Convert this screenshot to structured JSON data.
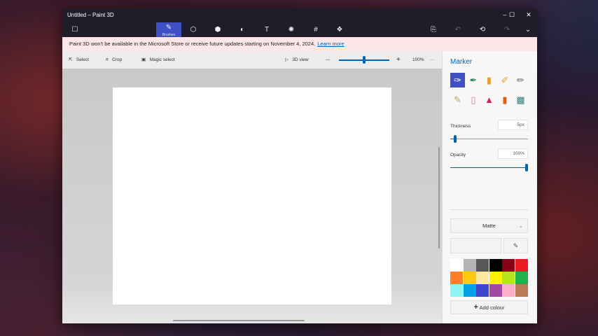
{
  "window": {
    "title": "Untitled – Paint 3D",
    "minimize": "–",
    "maximize": "☐",
    "close": "✕"
  },
  "toolbar": {
    "menu_icon": "☐",
    "tools": [
      {
        "name": "brushes",
        "icon": "✎",
        "label": "Brushes",
        "selected": true
      },
      {
        "name": "2d-shapes",
        "icon": "⬡"
      },
      {
        "name": "3d-shapes",
        "icon": "⬢"
      },
      {
        "name": "stickers",
        "icon": "◐"
      },
      {
        "name": "text",
        "icon": "T"
      },
      {
        "name": "effects",
        "icon": "✺"
      },
      {
        "name": "canvas",
        "icon": "#"
      },
      {
        "name": "3d-library",
        "icon": "❖"
      }
    ],
    "paste_icon": "⎘",
    "undo_icon": "↶",
    "history_icon": "⟲",
    "redo_icon": "↷",
    "expand_icon": "⌄"
  },
  "banner": {
    "text": "Paint 3D won't be available in the Microsoft Store or receive future updates starting on November 4, 2024.",
    "link": "Learn more"
  },
  "subbar": {
    "select": "Select",
    "crop": "Crop",
    "magic_select": "Magic select",
    "view3d": "3D view",
    "zoom": "100%",
    "zoom_fraction": 0.5,
    "more": "···",
    "minus": "—",
    "plus": "+"
  },
  "panel": {
    "title": "Marker",
    "brushes": [
      "marker",
      "calligraphy-pen",
      "oil-brush",
      "watercolor",
      "pixel-pen",
      "pencil",
      "eraser",
      "crayon",
      "spray-can",
      "fill"
    ],
    "selected_brush": "marker",
    "thickness_label": "Thickness",
    "thickness_value": "5px",
    "thickness_fraction": 0.05,
    "opacity_label": "Opacity",
    "opacity_value": "100%",
    "opacity_fraction": 1.0,
    "finish": "Matte",
    "add_colour": "Add colour",
    "palette": [
      "#ffffff",
      "#b4b4b4",
      "#585858",
      "#000000",
      "#880015",
      "#ed1c24",
      "#ff7f27",
      "#ffc90e",
      "#fde9a0",
      "#fff200",
      "#b5e61d",
      "#22b14c",
      "#8cf5f5",
      "#00a2e8",
      "#3f48cc",
      "#a349a4",
      "#ffaec9",
      "#b97a57"
    ]
  },
  "colors": {
    "accent": "#3f4fc4",
    "link": "#0063b1"
  }
}
